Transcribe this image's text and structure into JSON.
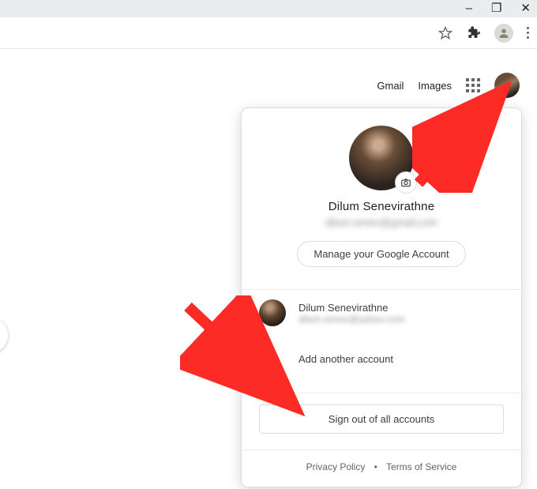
{
  "toolbar": {
    "gmail_label": "Gmail",
    "images_label": "Images",
    "apps_aria": "Google apps"
  },
  "account_card": {
    "name": "Dilum Senevirathne",
    "email": "dilum.senev@gmail.com",
    "manage_label": "Manage your Google Account",
    "camera_aria": "Change profile photo",
    "other_accounts": [
      {
        "name": "Dilum Senevirathne",
        "email": "dilum.senev@yahoo.com"
      }
    ],
    "add_account_label": "Add another account",
    "sign_out_label": "Sign out of all accounts",
    "privacy_label": "Privacy Policy",
    "terms_label": "Terms of Service"
  },
  "window_controls": {
    "minimize": "–",
    "maximize": "❐",
    "close": "✕"
  }
}
